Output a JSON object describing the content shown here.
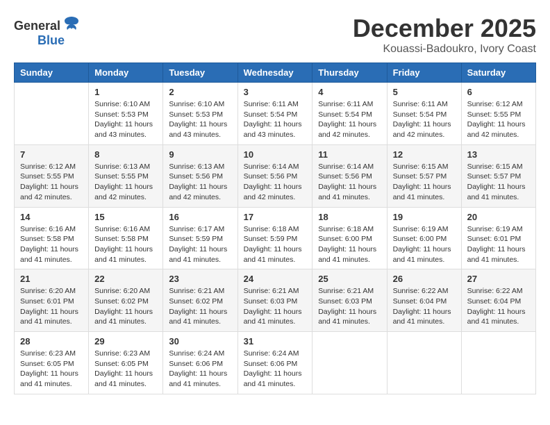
{
  "logo": {
    "general": "General",
    "blue": "Blue"
  },
  "title": "December 2025",
  "subtitle": "Kouassi-Badoukro, Ivory Coast",
  "weekdays": [
    "Sunday",
    "Monday",
    "Tuesday",
    "Wednesday",
    "Thursday",
    "Friday",
    "Saturday"
  ],
  "weeks": [
    [
      {
        "day": "",
        "sunrise": "",
        "sunset": "",
        "daylight": ""
      },
      {
        "day": "1",
        "sunrise": "Sunrise: 6:10 AM",
        "sunset": "Sunset: 5:53 PM",
        "daylight": "Daylight: 11 hours and 43 minutes."
      },
      {
        "day": "2",
        "sunrise": "Sunrise: 6:10 AM",
        "sunset": "Sunset: 5:53 PM",
        "daylight": "Daylight: 11 hours and 43 minutes."
      },
      {
        "day": "3",
        "sunrise": "Sunrise: 6:11 AM",
        "sunset": "Sunset: 5:54 PM",
        "daylight": "Daylight: 11 hours and 43 minutes."
      },
      {
        "day": "4",
        "sunrise": "Sunrise: 6:11 AM",
        "sunset": "Sunset: 5:54 PM",
        "daylight": "Daylight: 11 hours and 42 minutes."
      },
      {
        "day": "5",
        "sunrise": "Sunrise: 6:11 AM",
        "sunset": "Sunset: 5:54 PM",
        "daylight": "Daylight: 11 hours and 42 minutes."
      },
      {
        "day": "6",
        "sunrise": "Sunrise: 6:12 AM",
        "sunset": "Sunset: 5:55 PM",
        "daylight": "Daylight: 11 hours and 42 minutes."
      }
    ],
    [
      {
        "day": "7",
        "sunrise": "Sunrise: 6:12 AM",
        "sunset": "Sunset: 5:55 PM",
        "daylight": "Daylight: 11 hours and 42 minutes."
      },
      {
        "day": "8",
        "sunrise": "Sunrise: 6:13 AM",
        "sunset": "Sunset: 5:55 PM",
        "daylight": "Daylight: 11 hours and 42 minutes."
      },
      {
        "day": "9",
        "sunrise": "Sunrise: 6:13 AM",
        "sunset": "Sunset: 5:56 PM",
        "daylight": "Daylight: 11 hours and 42 minutes."
      },
      {
        "day": "10",
        "sunrise": "Sunrise: 6:14 AM",
        "sunset": "Sunset: 5:56 PM",
        "daylight": "Daylight: 11 hours and 42 minutes."
      },
      {
        "day": "11",
        "sunrise": "Sunrise: 6:14 AM",
        "sunset": "Sunset: 5:56 PM",
        "daylight": "Daylight: 11 hours and 41 minutes."
      },
      {
        "day": "12",
        "sunrise": "Sunrise: 6:15 AM",
        "sunset": "Sunset: 5:57 PM",
        "daylight": "Daylight: 11 hours and 41 minutes."
      },
      {
        "day": "13",
        "sunrise": "Sunrise: 6:15 AM",
        "sunset": "Sunset: 5:57 PM",
        "daylight": "Daylight: 11 hours and 41 minutes."
      }
    ],
    [
      {
        "day": "14",
        "sunrise": "Sunrise: 6:16 AM",
        "sunset": "Sunset: 5:58 PM",
        "daylight": "Daylight: 11 hours and 41 minutes."
      },
      {
        "day": "15",
        "sunrise": "Sunrise: 6:16 AM",
        "sunset": "Sunset: 5:58 PM",
        "daylight": "Daylight: 11 hours and 41 minutes."
      },
      {
        "day": "16",
        "sunrise": "Sunrise: 6:17 AM",
        "sunset": "Sunset: 5:59 PM",
        "daylight": "Daylight: 11 hours and 41 minutes."
      },
      {
        "day": "17",
        "sunrise": "Sunrise: 6:18 AM",
        "sunset": "Sunset: 5:59 PM",
        "daylight": "Daylight: 11 hours and 41 minutes."
      },
      {
        "day": "18",
        "sunrise": "Sunrise: 6:18 AM",
        "sunset": "Sunset: 6:00 PM",
        "daylight": "Daylight: 11 hours and 41 minutes."
      },
      {
        "day": "19",
        "sunrise": "Sunrise: 6:19 AM",
        "sunset": "Sunset: 6:00 PM",
        "daylight": "Daylight: 11 hours and 41 minutes."
      },
      {
        "day": "20",
        "sunrise": "Sunrise: 6:19 AM",
        "sunset": "Sunset: 6:01 PM",
        "daylight": "Daylight: 11 hours and 41 minutes."
      }
    ],
    [
      {
        "day": "21",
        "sunrise": "Sunrise: 6:20 AM",
        "sunset": "Sunset: 6:01 PM",
        "daylight": "Daylight: 11 hours and 41 minutes."
      },
      {
        "day": "22",
        "sunrise": "Sunrise: 6:20 AM",
        "sunset": "Sunset: 6:02 PM",
        "daylight": "Daylight: 11 hours and 41 minutes."
      },
      {
        "day": "23",
        "sunrise": "Sunrise: 6:21 AM",
        "sunset": "Sunset: 6:02 PM",
        "daylight": "Daylight: 11 hours and 41 minutes."
      },
      {
        "day": "24",
        "sunrise": "Sunrise: 6:21 AM",
        "sunset": "Sunset: 6:03 PM",
        "daylight": "Daylight: 11 hours and 41 minutes."
      },
      {
        "day": "25",
        "sunrise": "Sunrise: 6:21 AM",
        "sunset": "Sunset: 6:03 PM",
        "daylight": "Daylight: 11 hours and 41 minutes."
      },
      {
        "day": "26",
        "sunrise": "Sunrise: 6:22 AM",
        "sunset": "Sunset: 6:04 PM",
        "daylight": "Daylight: 11 hours and 41 minutes."
      },
      {
        "day": "27",
        "sunrise": "Sunrise: 6:22 AM",
        "sunset": "Sunset: 6:04 PM",
        "daylight": "Daylight: 11 hours and 41 minutes."
      }
    ],
    [
      {
        "day": "28",
        "sunrise": "Sunrise: 6:23 AM",
        "sunset": "Sunset: 6:05 PM",
        "daylight": "Daylight: 11 hours and 41 minutes."
      },
      {
        "day": "29",
        "sunrise": "Sunrise: 6:23 AM",
        "sunset": "Sunset: 6:05 PM",
        "daylight": "Daylight: 11 hours and 41 minutes."
      },
      {
        "day": "30",
        "sunrise": "Sunrise: 6:24 AM",
        "sunset": "Sunset: 6:06 PM",
        "daylight": "Daylight: 11 hours and 41 minutes."
      },
      {
        "day": "31",
        "sunrise": "Sunrise: 6:24 AM",
        "sunset": "Sunset: 6:06 PM",
        "daylight": "Daylight: 11 hours and 41 minutes."
      },
      {
        "day": "",
        "sunrise": "",
        "sunset": "",
        "daylight": ""
      },
      {
        "day": "",
        "sunrise": "",
        "sunset": "",
        "daylight": ""
      },
      {
        "day": "",
        "sunrise": "",
        "sunset": "",
        "daylight": ""
      }
    ]
  ]
}
